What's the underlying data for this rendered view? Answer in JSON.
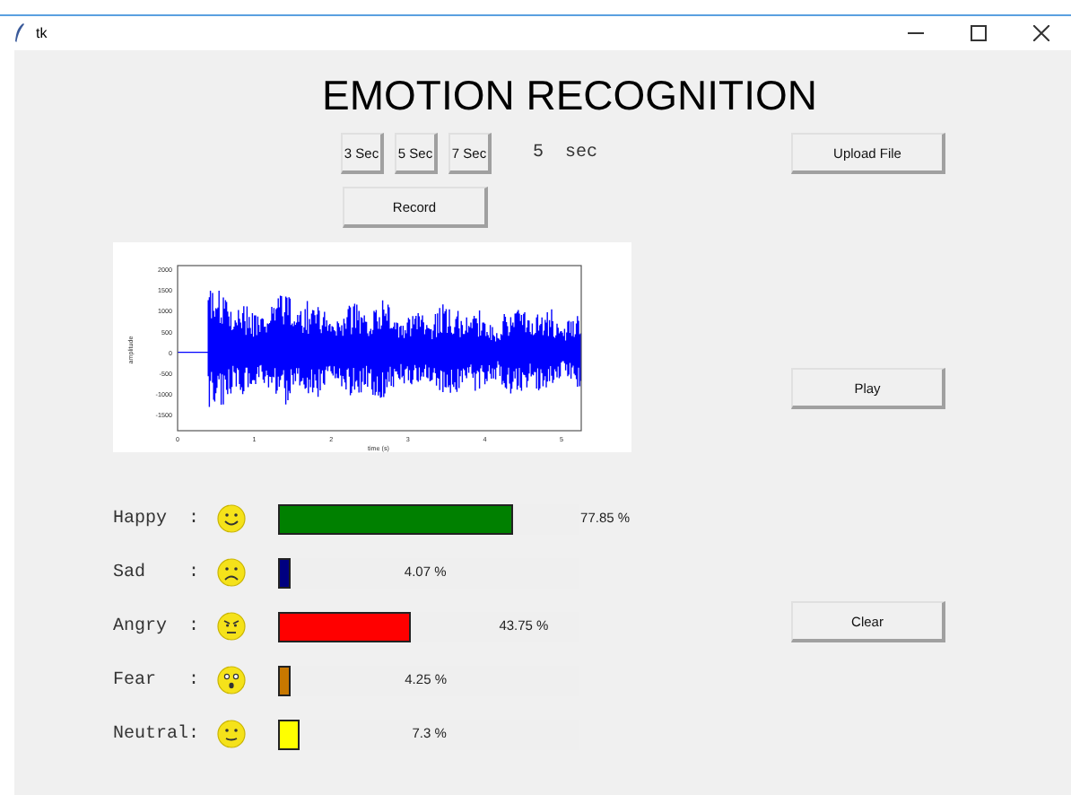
{
  "window": {
    "title": "tk"
  },
  "heading": "EMOTION RECOGNITION",
  "duration_buttons": [
    {
      "label": "3 Sec"
    },
    {
      "label": "5 Sec"
    },
    {
      "label": "7 Sec"
    }
  ],
  "duration_display": "5  sec",
  "record_button": "Record",
  "upload_button": "Upload File",
  "play_button": "Play",
  "clear_button": "Clear",
  "waveform": {
    "ylabel": "amplitude",
    "xlabel": "time (s)",
    "y_tick_labels": [
      "2000",
      "1500",
      "1000",
      "500",
      "0",
      "-500",
      "-1000",
      "-1500"
    ],
    "x_tick_labels": [
      "0",
      "1",
      "2",
      "3",
      "4",
      "5"
    ]
  },
  "emotions": [
    {
      "label": "Happy  :",
      "kind": "smile",
      "color": "#008000",
      "level": 0.7785,
      "reading": "77.85 %"
    },
    {
      "label": "Sad    :",
      "kind": "frown",
      "color": "#000080",
      "level": 0.0407,
      "reading": "4.07 %"
    },
    {
      "label": "Angry  :",
      "kind": "angry",
      "color": "#ff0000",
      "level": 0.4375,
      "reading": "43.75 %"
    },
    {
      "label": "Fear   :",
      "kind": "scared",
      "color": "#c87800",
      "level": 0.0425,
      "reading": "4.25 %"
    },
    {
      "label": "Neutral:",
      "kind": "neutral",
      "color": "#ffff00",
      "level": 0.073,
      "reading": "7.3 %"
    }
  ]
}
